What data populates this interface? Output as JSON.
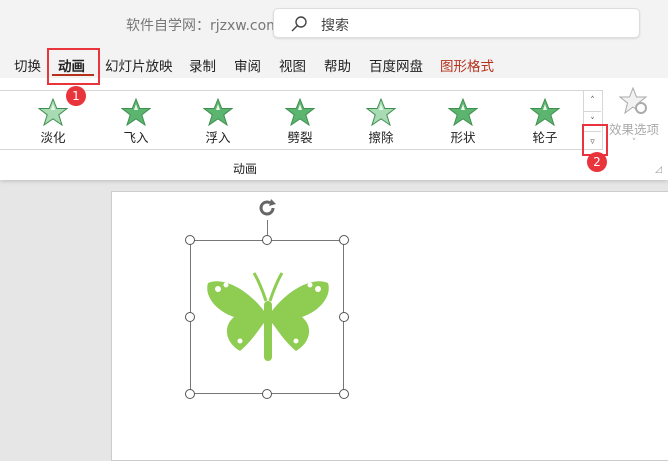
{
  "header": {
    "site_label": "软件自学网：rjzxw.com",
    "search_placeholder": "搜索"
  },
  "tabs": [
    {
      "label": "切换"
    },
    {
      "label": "动画"
    },
    {
      "label": "幻灯片放映"
    },
    {
      "label": "录制"
    },
    {
      "label": "审阅"
    },
    {
      "label": "视图"
    },
    {
      "label": "帮助"
    },
    {
      "label": "百度网盘"
    },
    {
      "label": "图形格式"
    }
  ],
  "gallery": {
    "items": [
      {
        "label": "淡化"
      },
      {
        "label": "飞入"
      },
      {
        "label": "浮入"
      },
      {
        "label": "劈裂"
      },
      {
        "label": "擦除"
      },
      {
        "label": "形状"
      },
      {
        "label": "轮子"
      }
    ],
    "scroll_up": "˄",
    "scroll_down": "˅",
    "more": "▿"
  },
  "effect_options": {
    "label": "效果选项",
    "chevron": "˅"
  },
  "group_label": "动画",
  "annotations": {
    "one": "1",
    "two": "2"
  },
  "colors": {
    "accent": "#b5311c",
    "highlight": "#e8343a",
    "butterfly": "#8fcc52",
    "star": "#5cb56e"
  }
}
